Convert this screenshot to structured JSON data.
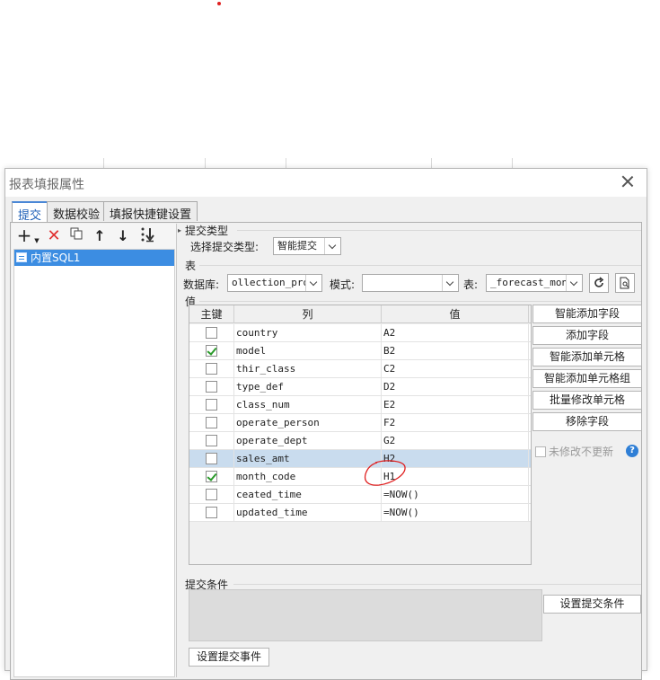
{
  "dialog": {
    "title": "报表填报属性",
    "tabs": [
      {
        "label": "提交",
        "active": true
      },
      {
        "label": "数据校验",
        "active": false
      },
      {
        "label": "填报快捷键设置",
        "active": false
      }
    ]
  },
  "left_panel": {
    "toolbar_icons": [
      "add-icon",
      "delete-icon",
      "copy-icon",
      "move-up-icon",
      "move-down-icon",
      "sort-icon"
    ],
    "tree_items": [
      {
        "label": "内置SQL1",
        "selected": true
      }
    ]
  },
  "submit_type": {
    "section_label": "提交类型",
    "select_label": "选择提交类型:",
    "value": "智能提交"
  },
  "table_section": {
    "section_label": "表",
    "database_label": "数据库:",
    "database_value": "ollection_pro",
    "schema_label": "模式:",
    "schema_value": "",
    "table_label": "表:",
    "table_value": "_forecast_mon"
  },
  "values_section": {
    "section_label": "值",
    "columns": [
      "主键",
      "列",
      "值"
    ],
    "rows": [
      {
        "key": false,
        "column": "country",
        "value": "A2",
        "selected": false
      },
      {
        "key": true,
        "column": "model",
        "value": "B2",
        "selected": false
      },
      {
        "key": false,
        "column": "thir_class",
        "value": "C2",
        "selected": false
      },
      {
        "key": false,
        "column": "type_def",
        "value": "D2",
        "selected": false
      },
      {
        "key": false,
        "column": "class_num",
        "value": "E2",
        "selected": false
      },
      {
        "key": false,
        "column": "operate_person",
        "value": "F2",
        "selected": false
      },
      {
        "key": false,
        "column": "operate_dept",
        "value": "G2",
        "selected": false
      },
      {
        "key": false,
        "column": "sales_amt",
        "value": "H2",
        "selected": true
      },
      {
        "key": true,
        "column": "month_code",
        "value": "H1",
        "selected": false
      },
      {
        "key": false,
        "column": "ceated_time",
        "value": "=NOW()",
        "selected": false
      },
      {
        "key": false,
        "column": "updated_time",
        "value": "=NOW()",
        "selected": false
      }
    ],
    "side_buttons": [
      "智能添加字段",
      "添加字段",
      "智能添加单元格",
      "智能添加单元格组",
      "批量修改单元格",
      "移除字段"
    ],
    "no_change_label": "未修改不更新",
    "help_icon": "?"
  },
  "submit_condition": {
    "section_label": "提交条件",
    "button_label": "设置提交条件"
  },
  "submit_event": {
    "button_label": "设置提交事件"
  },
  "colors": {
    "selection_blue": "#3c8de2",
    "row_highlight": "#c9dcee",
    "check_green": "#2a9a2a",
    "annotation_red": "#e02020"
  }
}
